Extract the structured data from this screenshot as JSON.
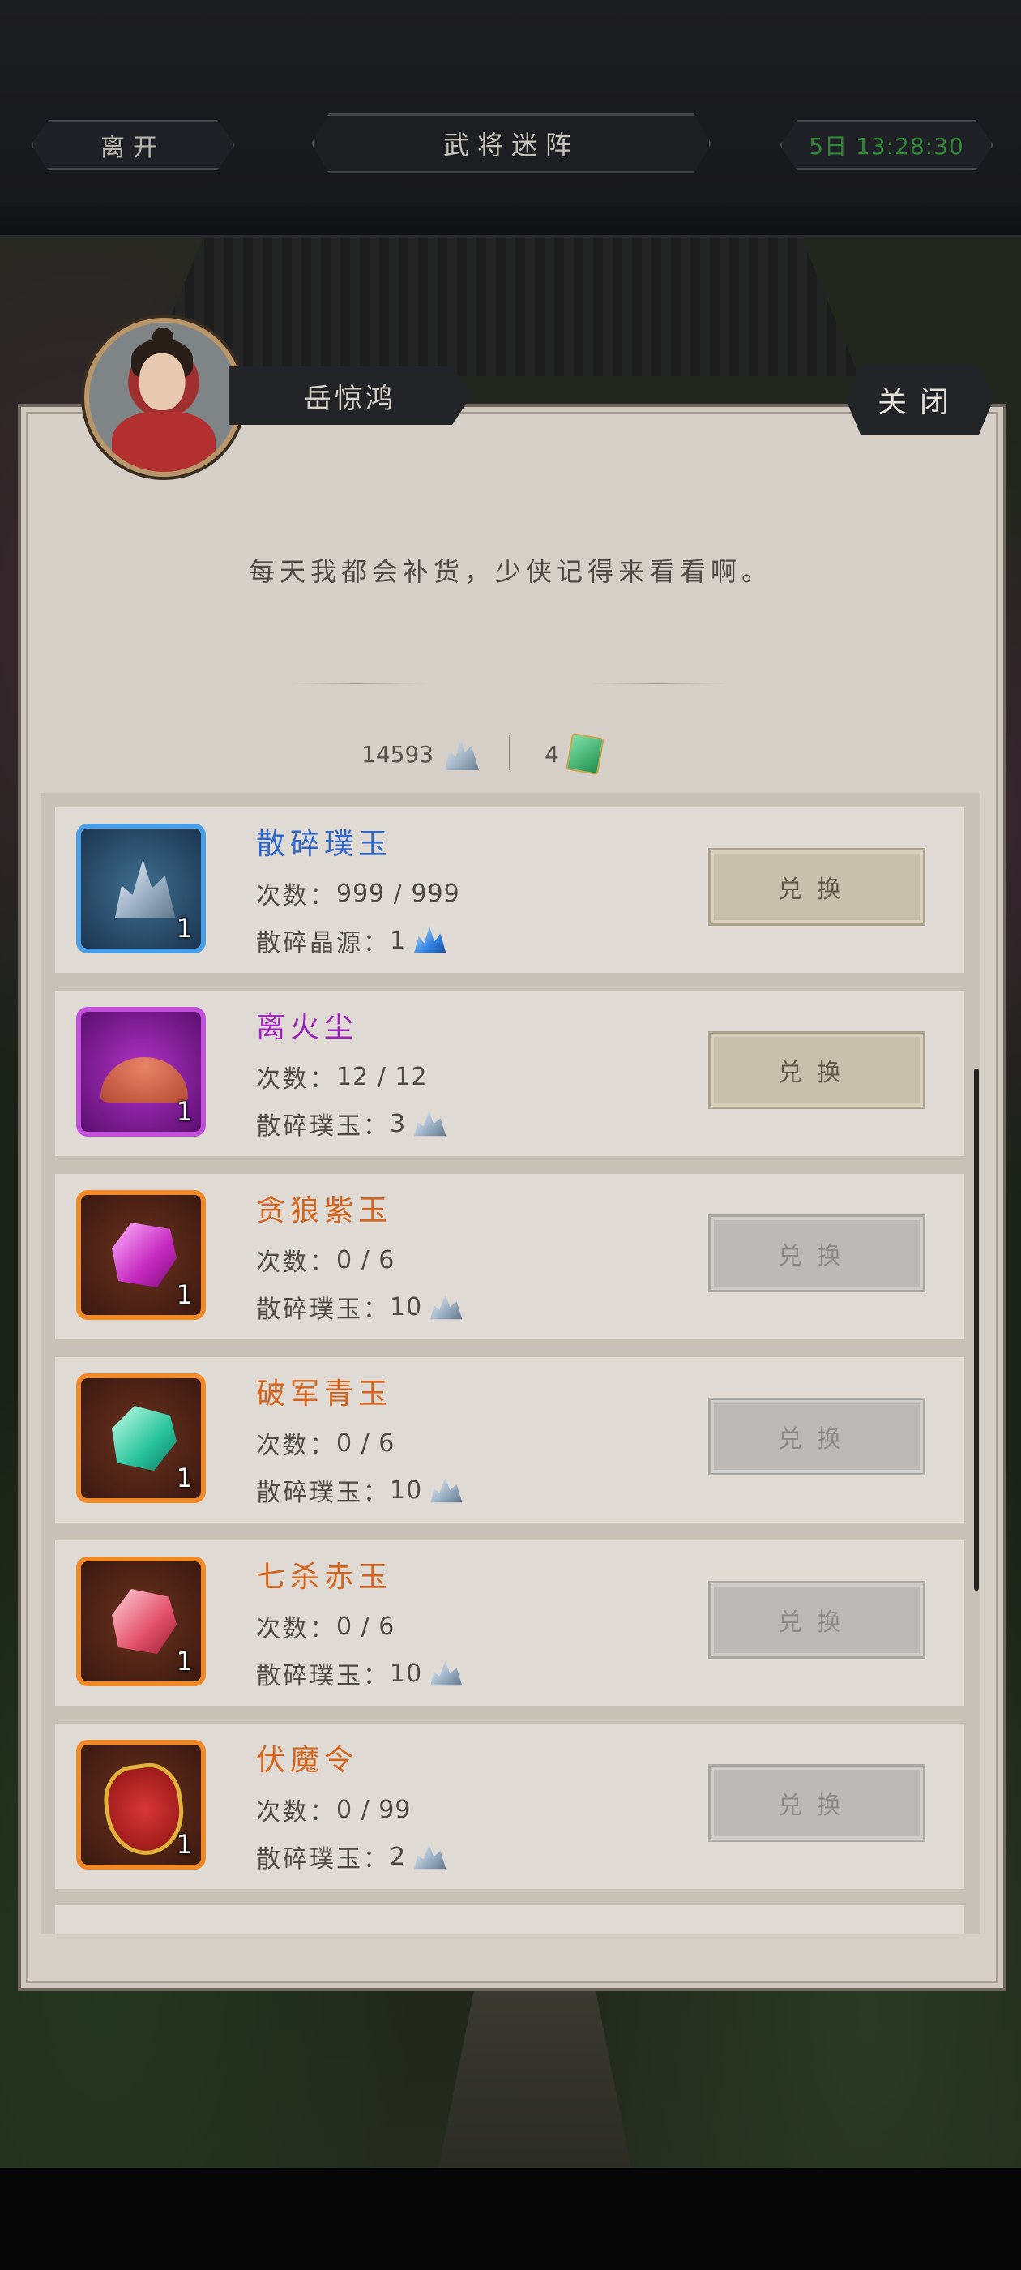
{
  "topbar": {
    "leave_label": "离开",
    "title": "武将迷阵",
    "timer": "5日 13:28:30",
    "timer_color": "#2e8a37"
  },
  "npc": {
    "name": "岳惊鸿",
    "close_label": "关闭",
    "dialog": "每天我都会补货，少侠记得来看看啊。"
  },
  "currency": [
    {
      "amount": "14593",
      "icon": "broken-jade-shards-icon"
    },
    {
      "amount": "4",
      "icon": "green-jade-token-icon"
    }
  ],
  "items": [
    {
      "name": "散碎璞玉",
      "rarity_color": "#2f67c9",
      "slot": "blue",
      "icon": "broken-jade-icon",
      "qty": "1",
      "count_label": "次数：",
      "count": "999 / 999",
      "cost_label": "散碎晶源：",
      "cost": "1",
      "cost_icon": "crystal-source-icon",
      "button": "兑换",
      "enabled": true
    },
    {
      "name": "离火尘",
      "rarity_color": "#9b22b8",
      "slot": "purple",
      "icon": "fire-dust-icon",
      "qty": "1",
      "count_label": "次数：",
      "count": "12 / 12",
      "cost_label": "散碎璞玉：",
      "cost": "3",
      "cost_icon": "broken-jade-icon",
      "button": "兑换",
      "enabled": true
    },
    {
      "name": "贪狼紫玉",
      "rarity_color": "#d3641d",
      "slot": "orange",
      "icon": "purple-jade-icon",
      "qty": "1",
      "count_label": "次数：",
      "count": "0 / 6",
      "cost_label": "散碎璞玉：",
      "cost": "10",
      "cost_icon": "broken-jade-icon",
      "button": "兑换",
      "enabled": false
    },
    {
      "name": "破军青玉",
      "rarity_color": "#d3641d",
      "slot": "orange",
      "icon": "teal-jade-icon",
      "qty": "1",
      "count_label": "次数：",
      "count": "0 / 6",
      "cost_label": "散碎璞玉：",
      "cost": "10",
      "cost_icon": "broken-jade-icon",
      "button": "兑换",
      "enabled": false
    },
    {
      "name": "七杀赤玉",
      "rarity_color": "#d3641d",
      "slot": "orange",
      "icon": "red-jade-icon",
      "qty": "1",
      "count_label": "次数：",
      "count": "0 / 6",
      "cost_label": "散碎璞玉：",
      "cost": "10",
      "cost_icon": "broken-jade-icon",
      "button": "兑换",
      "enabled": false
    },
    {
      "name": "伏魔令",
      "rarity_color": "#d3641d",
      "slot": "orange",
      "icon": "demon-token-icon",
      "qty": "1",
      "count_label": "次数：",
      "count": "0 / 99",
      "cost_label": "散碎璞玉：",
      "cost": "2",
      "cost_icon": "broken-jade-icon",
      "button": "兑换",
      "enabled": false
    }
  ]
}
